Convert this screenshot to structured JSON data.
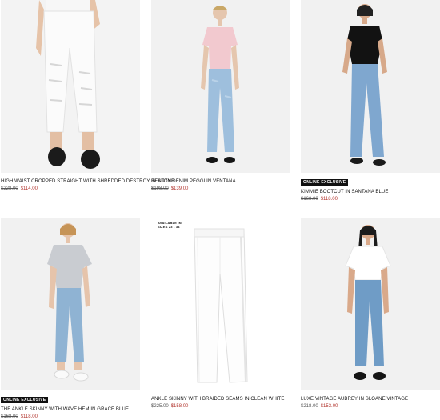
{
  "products": [
    {
      "badge": "",
      "availability": "",
      "title": "HIGH WAIST CROPPED STRAIGHT WITH SHREDDED DESTROY IN STONE",
      "price_old": "$228.00",
      "price_new": "$114.00"
    },
    {
      "badge": "",
      "availability": "",
      "title": "BEAUTY DENIM PEGGI IN VENTANA",
      "price_old": "$198.00",
      "price_new": "$139.00"
    },
    {
      "badge": "ONLINE EXCLUSIVE",
      "availability": "",
      "title": "KIMMIE BOOTCUT IN SANTANA BLUE",
      "price_old": "$168.00",
      "price_new": "$118.00"
    },
    {
      "badge": "ONLINE EXCLUSIVE",
      "availability": "",
      "title": "THE ANKLE SKINNY WITH WAVE HEM IN GRACE BLUE",
      "price_old": "$168.00",
      "price_new": "$118.00"
    },
    {
      "badge": "",
      "availability": "AVAILABLE IN SIZES 23 - 34",
      "title": "ANKLE SKINNY WITH BRAIDED SEAMS IN CLEAN WHITE",
      "price_old": "$225.00",
      "price_new": "$158.00"
    },
    {
      "badge": "",
      "availability": "",
      "title": "LUXE VINTAGE AUBREY IN SLOANE VINTAGE",
      "price_old": "$218.00",
      "price_new": "$153.00"
    }
  ]
}
